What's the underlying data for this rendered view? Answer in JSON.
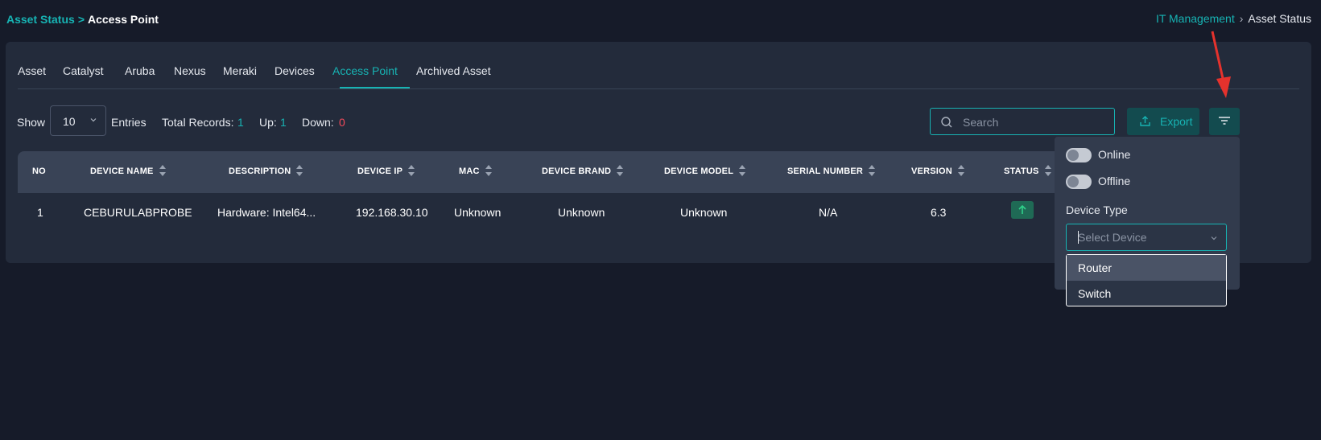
{
  "breadcrumb_left": {
    "parent": "Asset Status",
    "separator": ">",
    "current": "Access Point"
  },
  "breadcrumb_right": {
    "parent": "IT Management",
    "separator": "›",
    "current": "Asset Status"
  },
  "tabs": [
    {
      "label": "Asset"
    },
    {
      "label": "Catalyst"
    },
    {
      "label": "Aruba"
    },
    {
      "label": "Nexus"
    },
    {
      "label": "Meraki"
    },
    {
      "label": "Devices"
    },
    {
      "label": "Access Point",
      "active": true
    },
    {
      "label": "Archived Asset"
    }
  ],
  "toolbar": {
    "show_label": "Show",
    "entries_value": "10",
    "entries_label": "Entries",
    "total_label": "Total Records:",
    "total_value": "1",
    "up_label": "Up:",
    "up_value": "1",
    "down_label": "Down:",
    "down_value": "0",
    "search_placeholder": "Search",
    "export_label": "Export"
  },
  "table": {
    "columns": [
      "NO",
      "DEVICE NAME",
      "DESCRIPTION",
      "DEVICE IP",
      "MAC",
      "DEVICE BRAND",
      "DEVICE MODEL",
      "SERIAL NUMBER",
      "VERSION",
      "STATUS"
    ],
    "rows": [
      {
        "no": "1",
        "device_name": "CEBURULABPROBE",
        "description": "Hardware: Intel64...",
        "device_ip": "192.168.30.10",
        "mac": "Unknown",
        "device_brand": "Unknown",
        "device_model": "Unknown",
        "serial_number": "N/A",
        "version": "6.3",
        "status": "up"
      }
    ]
  },
  "filter": {
    "online_label": "Online",
    "online_on": false,
    "offline_label": "Offline",
    "offline_on": false,
    "device_type_label": "Device Type",
    "select_placeholder": "Select Device",
    "options": [
      "Router",
      "Switch"
    ]
  },
  "colors": {
    "accent": "#17b3b3",
    "background": "#161b29",
    "card": "#232b3b",
    "down": "#f44a5b",
    "status_up": "#1f6a55",
    "annotation_arrow": "#e5322d"
  }
}
